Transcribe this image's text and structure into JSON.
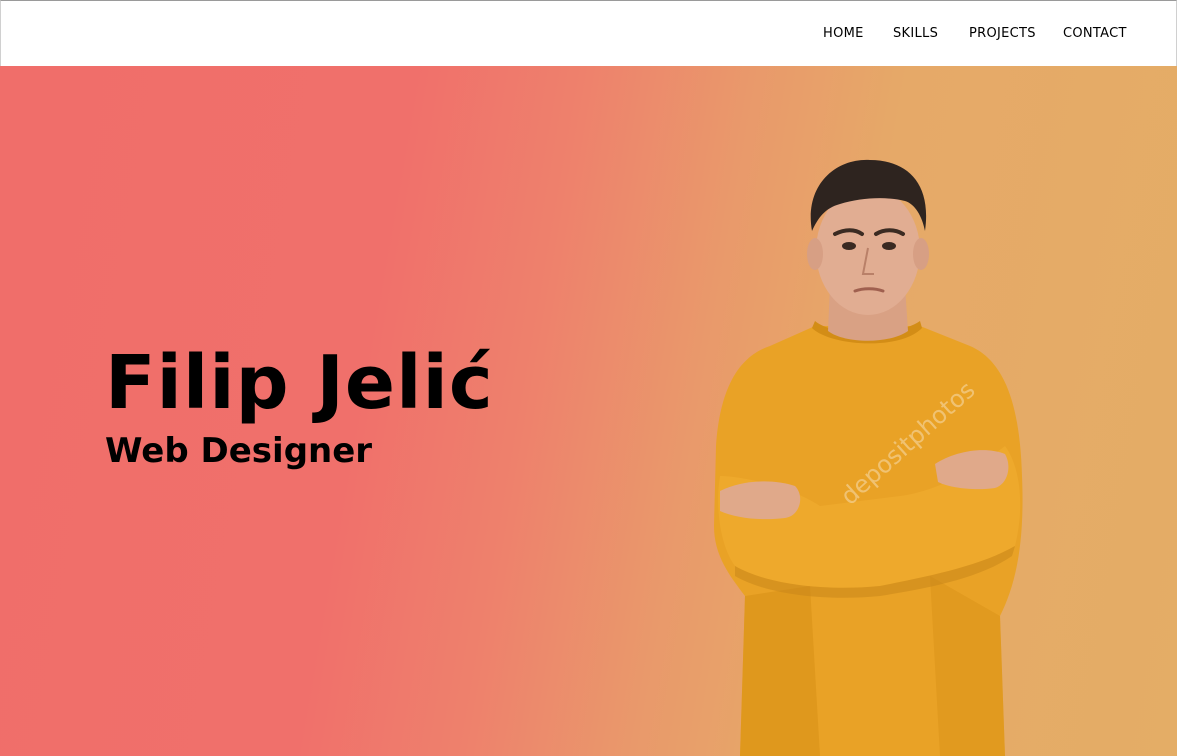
{
  "nav": {
    "items": [
      {
        "label": "HOME"
      },
      {
        "label": "SKILLS"
      },
      {
        "label": "PROJECTS"
      },
      {
        "label": "CONTACT"
      }
    ]
  },
  "hero": {
    "name": "Filip Jelić",
    "role": "Web Designer",
    "photo_watermark": "depositphotos"
  },
  "colors": {
    "gradient_start": "#f06e6a",
    "gradient_end": "#e4ad66",
    "sweater": "#e9a226",
    "text": "#000000"
  }
}
